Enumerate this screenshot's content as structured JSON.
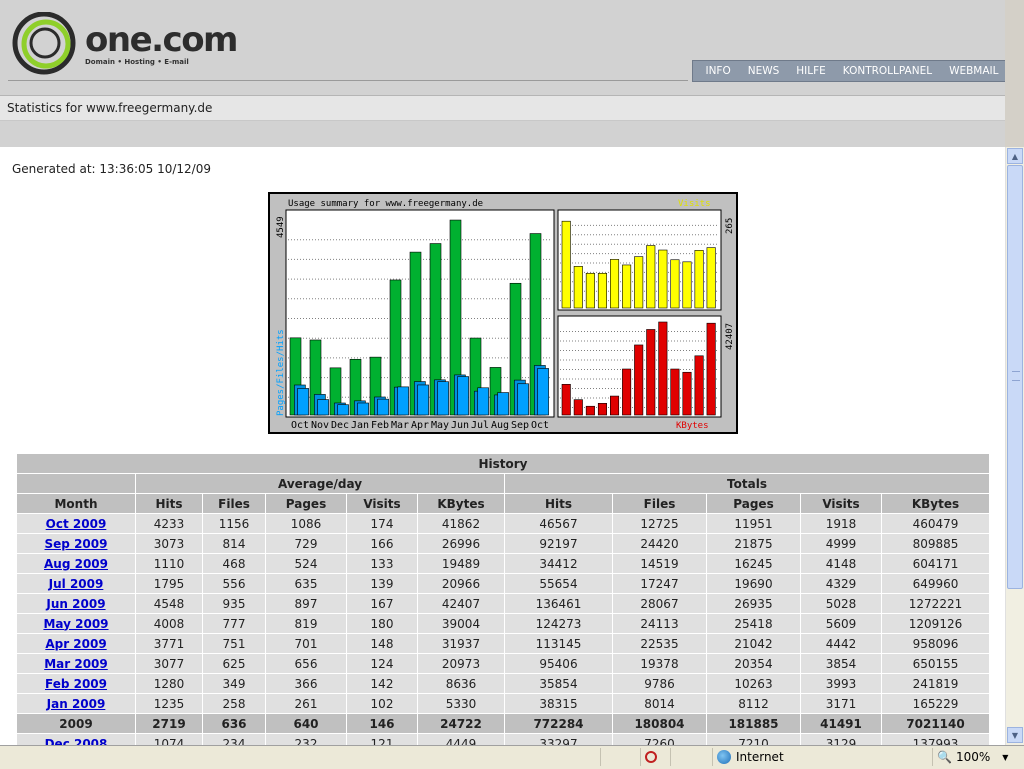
{
  "header": {
    "logo_text": "one.com",
    "logo_tagline": "Domain • Hosting • E-mail",
    "nav": [
      "INFO",
      "NEWS",
      "HILFE",
      "KONTROLLPANEL",
      "WEBMAIL"
    ]
  },
  "subtitle": "Statistics for www.freegermany.de",
  "generated": "Generated at: 13:36:05 10/12/09",
  "colors": {
    "hits": "#00b030",
    "files_pages": "#00a0ff",
    "visits": "#ffff00",
    "kbytes": "#e00000",
    "nav_bg": "#8e9aaa"
  },
  "chart_data": {
    "type": "bar",
    "title": "Usage summary for www.freegermany.de",
    "categories": [
      "Oct",
      "Nov",
      "Dec",
      "Jan",
      "Feb",
      "Mar",
      "Apr",
      "May",
      "Jun",
      "Jul",
      "Aug",
      "Sep",
      "Oct"
    ],
    "left_ylabel": "Pages/Files/Hits",
    "left_ymax_label": "4549",
    "left_ymax": 4549,
    "series": [
      {
        "name": "Hits",
        "values": [
          1800,
          1750,
          1100,
          1300,
          1350,
          3150,
          3800,
          4000,
          4548,
          1795,
          1110,
          3073,
          4233
        ]
      },
      {
        "name": "Files",
        "values": [
          700,
          480,
          280,
          330,
          420,
          650,
          780,
          820,
          935,
          556,
          468,
          814,
          1156
        ]
      },
      {
        "name": "Pages",
        "values": [
          620,
          360,
          240,
          280,
          370,
          656,
          701,
          777,
          897,
          635,
          524,
          729,
          1086
        ]
      }
    ],
    "visits": {
      "label": "Visits",
      "ymax_label": "265",
      "ymax": 265,
      "values": [
        250,
        120,
        100,
        100,
        140,
        124,
        148,
        180,
        167,
        139,
        133,
        166,
        174
      ]
    },
    "kbytes": {
      "label": "KBytes",
      "ymax_label": "42407",
      "ymax": 42407,
      "values": [
        14000,
        7000,
        4000,
        5330,
        8636,
        20973,
        31937,
        39004,
        42407,
        20966,
        19489,
        26996,
        41862
      ]
    }
  },
  "history": {
    "title": "History",
    "group_avg": "Average/day",
    "group_tot": "Totals",
    "columns": [
      "Month",
      "Hits",
      "Files",
      "Pages",
      "Visits",
      "KBytes",
      "Hits",
      "Files",
      "Pages",
      "Visits",
      "KBytes"
    ],
    "rows": [
      [
        "Oct 2009",
        "4233",
        "1156",
        "1086",
        "174",
        "41862",
        "46567",
        "12725",
        "11951",
        "1918",
        "460479"
      ],
      [
        "Sep 2009",
        "3073",
        "814",
        "729",
        "166",
        "26996",
        "92197",
        "24420",
        "21875",
        "4999",
        "809885"
      ],
      [
        "Aug 2009",
        "1110",
        "468",
        "524",
        "133",
        "19489",
        "34412",
        "14519",
        "16245",
        "4148",
        "604171"
      ],
      [
        "Jul 2009",
        "1795",
        "556",
        "635",
        "139",
        "20966",
        "55654",
        "17247",
        "19690",
        "4329",
        "649960"
      ],
      [
        "Jun 2009",
        "4548",
        "935",
        "897",
        "167",
        "42407",
        "136461",
        "28067",
        "26935",
        "5028",
        "1272221"
      ],
      [
        "May 2009",
        "4008",
        "777",
        "819",
        "180",
        "39004",
        "124273",
        "24113",
        "25418",
        "5609",
        "1209126"
      ],
      [
        "Apr 2009",
        "3771",
        "751",
        "701",
        "148",
        "31937",
        "113145",
        "22535",
        "21042",
        "4442",
        "958096"
      ],
      [
        "Mar 2009",
        "3077",
        "625",
        "656",
        "124",
        "20973",
        "95406",
        "19378",
        "20354",
        "3854",
        "650155"
      ],
      [
        "Feb 2009",
        "1280",
        "349",
        "366",
        "142",
        "8636",
        "35854",
        "9786",
        "10263",
        "3993",
        "241819"
      ],
      [
        "Jan 2009",
        "1235",
        "258",
        "261",
        "102",
        "5330",
        "38315",
        "8014",
        "8112",
        "3171",
        "165229"
      ]
    ],
    "total": [
      "2009",
      "2719",
      "636",
      "640",
      "146",
      "24722",
      "772284",
      "180804",
      "181885",
      "41491",
      "7021140"
    ],
    "partial_row": [
      "Dec 2008",
      "1074",
      "234",
      "232",
      "121",
      "4449",
      "33297",
      "7260",
      "7210",
      "3129",
      "137993"
    ]
  },
  "statusbar": {
    "zone": "Internet",
    "zoom": "100%"
  }
}
